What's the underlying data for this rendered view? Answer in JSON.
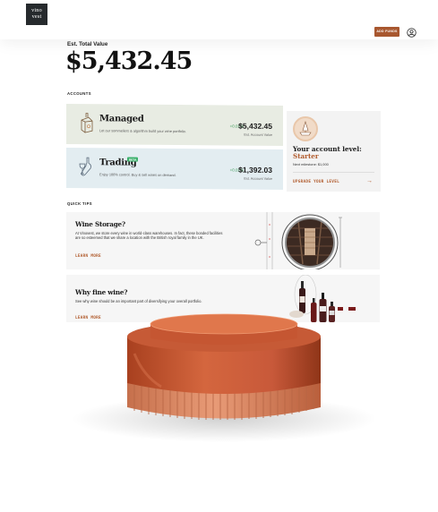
{
  "header": {
    "logo_line1": "vino",
    "logo_line2": "vest",
    "add_funds_label": "ADD FUNDS",
    "user_icon": "user-circle-icon"
  },
  "portfolio": {
    "est_total_label": "Est. Total Value",
    "total_value": "$5,432.45"
  },
  "accounts": {
    "section_label": "ACCOUNTS",
    "items": [
      {
        "title": "Managed",
        "description": "Let our sommeliers & algorithm build your wine portfolio.",
        "change_pct": "+0.01%",
        "value": "$5,432.45",
        "value_label": "Est. Account Value",
        "icon": "wine-box-icon"
      },
      {
        "title": "Trading",
        "badge": "BETA",
        "description": "Enjoy 100% control. Buy & sell wines on demand.",
        "change_pct": "+0.01%",
        "value": "$1,392.03",
        "value_label": "Est. Account Value",
        "icon": "wine-glass-bottle-icon"
      }
    ]
  },
  "account_level": {
    "title": "Your account level:",
    "level": "Starter",
    "next_milestone": "Next milestone: $1,000",
    "upgrade_label": "UPGRADE YOUR LEVEL",
    "arrow": "→",
    "icon": "level-medal-icon"
  },
  "quick_tips": {
    "section_label": "QUICK TIPS",
    "items": [
      {
        "title": "Wine Storage?",
        "text": "At Vinovest, we store every wine in world-class warehouses. In fact, these bonded facilities are so esteemed that we share a location with the British royal family in the UK.",
        "link": "LEARN MORE",
        "illustration": "wine-vault-illustration"
      },
      {
        "title": "Why fine wine?",
        "text": "See why wine should be an important part of diversifying your overall portfolio.",
        "link": "LEARN MORE",
        "illustration": "wine-bottles-illustration"
      }
    ]
  },
  "colors": {
    "accent": "#b15c2e",
    "add_funds_bg": "#a8572f",
    "positive": "#3b9b57",
    "managed_card_bg": "#e8ece3",
    "trading_card_bg": "#e3edf1",
    "product_orange": "#d4663e"
  }
}
